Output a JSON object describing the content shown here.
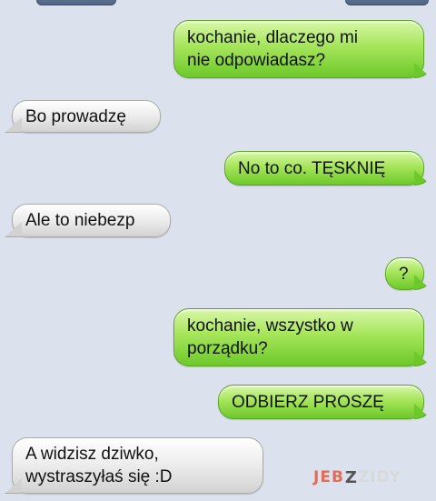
{
  "messages": [
    {
      "side": "sent",
      "text": "kochanie, dlaczego mi\nnie odpowiadasz?"
    },
    {
      "side": "received",
      "text": "Bo prowadzę"
    },
    {
      "side": "sent",
      "text": "No to co. TĘSKNIĘ"
    },
    {
      "side": "received",
      "text": "Ale to niebezp"
    },
    {
      "side": "sent",
      "text": "?"
    },
    {
      "side": "sent",
      "text": "kochanie, wszystko w\nporządku?"
    },
    {
      "side": "sent",
      "text": "ODBIERZ PROSZĘ"
    },
    {
      "side": "received",
      "text": "A widzisz dziwko,\nwystraszyłaś się :D"
    }
  ],
  "watermark": {
    "part1": "JEB",
    "part2": "Z",
    "part3": "ZIDY"
  },
  "colors": {
    "sent_bubble": "#7fd13b",
    "received_bubble": "#e9e9e9",
    "background": "#dbe2ed"
  }
}
